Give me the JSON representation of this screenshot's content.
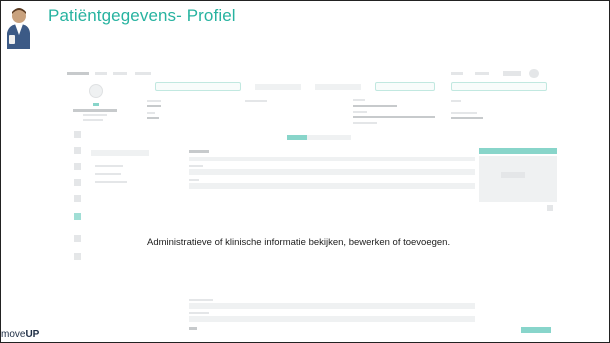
{
  "slide": {
    "title": "Patiëntgegevens- Profiel",
    "description": "Administratieve of klinische informatie bekijken, bewerken of toevoegen.",
    "brand_light": "move",
    "brand_bold": "UP"
  },
  "colors": {
    "accent": "#27b3a0",
    "brand_dark": "#1d2d44"
  }
}
